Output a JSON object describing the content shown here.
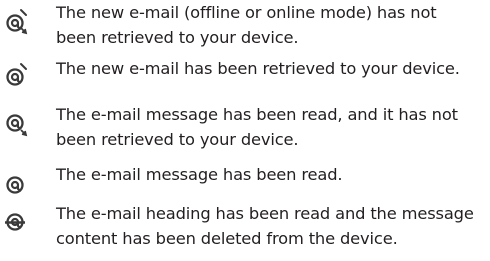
{
  "icon_legend": {
    "items": [
      {
        "icon": "new-email-not-retrieved-icon",
        "description": "The new e-mail (offline or online mode) has not\nbeen retrieved to your device."
      },
      {
        "icon": "new-email-retrieved-icon",
        "description": "The new e-mail has been retrieved to your device."
      },
      {
        "icon": "read-email-not-retrieved-icon",
        "description": "The e-mail message has been read, and it has not\nbeen retrieved to your device."
      },
      {
        "icon": "read-email-icon",
        "description": "The e-mail message has been read."
      },
      {
        "icon": "content-deleted-email-icon",
        "description": "The e-mail heading has been read and the message\ncontent has been deleted from the device."
      }
    ]
  },
  "colors": {
    "text": "#231f20",
    "icon": "#3a3a3a"
  }
}
